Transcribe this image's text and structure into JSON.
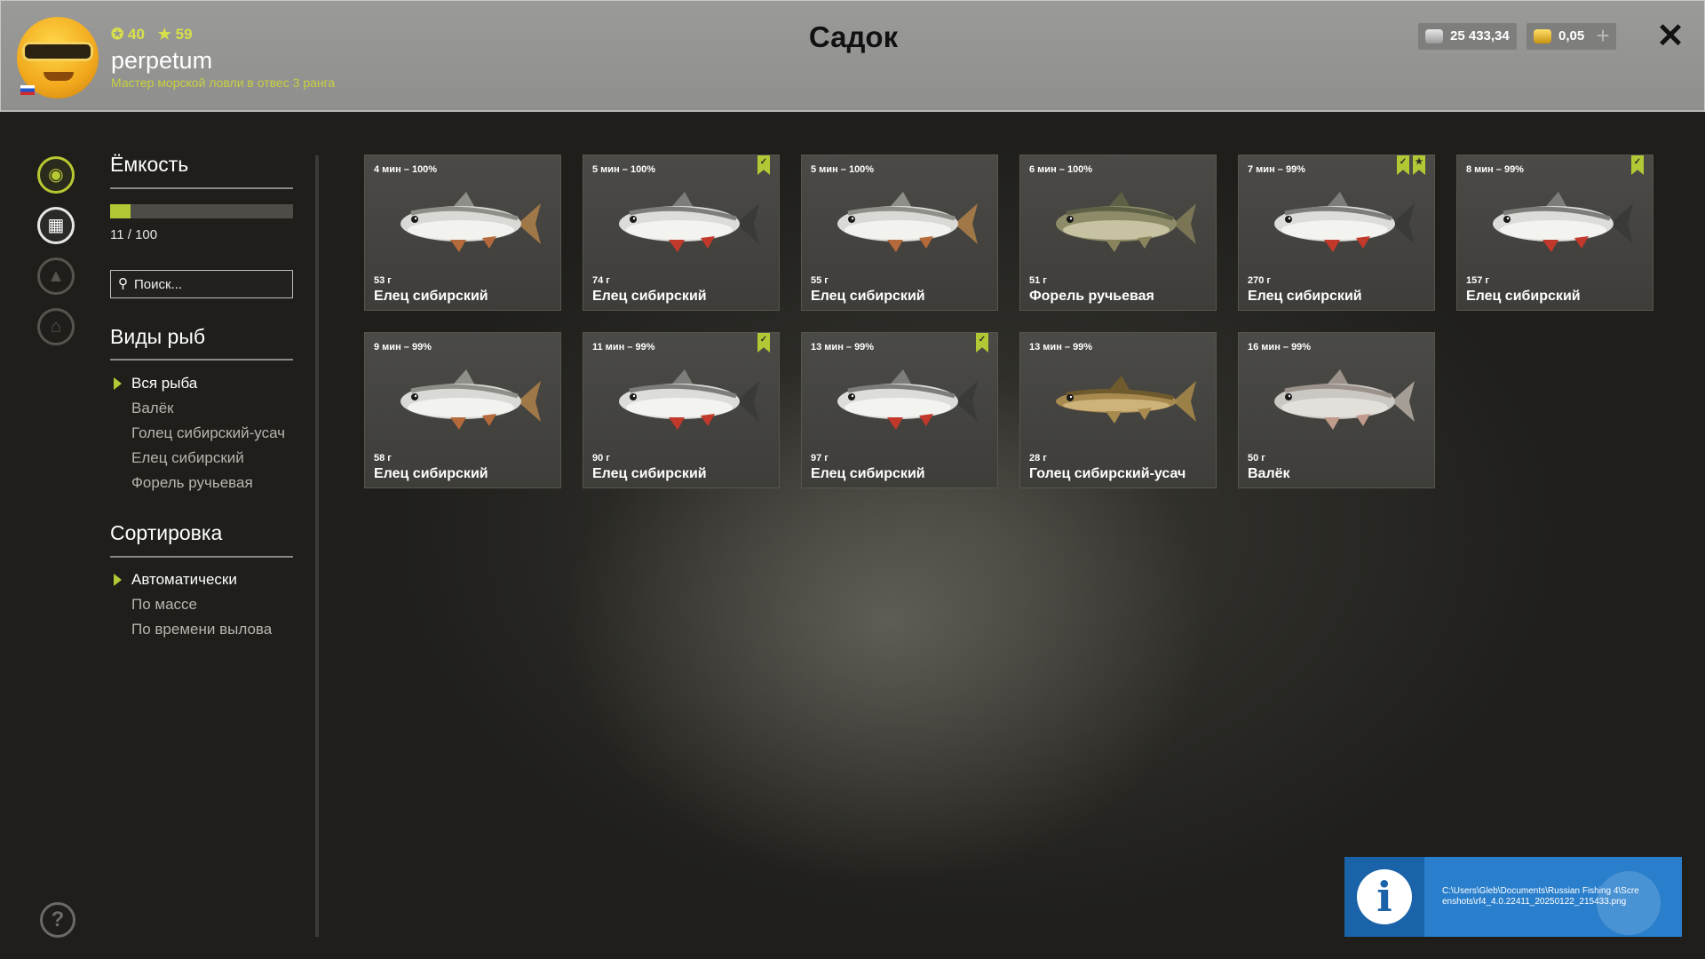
{
  "header": {
    "title": "Садок",
    "player": {
      "level": "40",
      "rank_points": "59",
      "nickname": "perpetum",
      "rank_title": "Мастер морской ловли в отвес 3 ранга"
    },
    "currency": {
      "silver": "25 433,34",
      "gold": "0,05",
      "add_label": "+"
    },
    "close_label": "✕"
  },
  "rail": [
    {
      "icon": "fish-icon",
      "state": "active",
      "glyph": "◉"
    },
    {
      "icon": "keepnet-icon",
      "state": "selected",
      "glyph": "▦"
    },
    {
      "icon": "camp-icon",
      "state": "disabled",
      "glyph": "▲"
    },
    {
      "icon": "home-icon",
      "state": "disabled",
      "glyph": "⌂"
    }
  ],
  "help_label": "?",
  "filters": {
    "capacity_title": "Ёмкость",
    "capacity_current": 11,
    "capacity_max": 100,
    "capacity_text": "11 / 100",
    "search_placeholder": "Поиск...",
    "species_title": "Виды рыб",
    "species": [
      "Вся рыба",
      "Валёк",
      "Голец сибирский-усач",
      "Елец сибирский",
      "Форель ручьевая"
    ],
    "species_selected": 0,
    "sort_title": "Сортировка",
    "sort_options": [
      "Автоматически",
      "По массе",
      "По времени вылова"
    ],
    "sort_selected": 0
  },
  "fish": [
    {
      "time": "4 мин – 100%",
      "weight": "53 г",
      "name": "Елец сибирский",
      "type": "dace-pale",
      "bookmarks": []
    },
    {
      "time": "5 мин – 100%",
      "weight": "74 г",
      "name": "Елец сибирский",
      "type": "dace-dark",
      "bookmarks": [
        "check"
      ]
    },
    {
      "time": "5 мин – 100%",
      "weight": "55 г",
      "name": "Елец сибирский",
      "type": "dace-pale",
      "bookmarks": []
    },
    {
      "time": "6 мин – 100%",
      "weight": "51 г",
      "name": "Форель ручьевая",
      "type": "trout",
      "bookmarks": []
    },
    {
      "time": "7 мин – 99%",
      "weight": "270 г",
      "name": "Елец сибирский",
      "type": "dace-dark",
      "bookmarks": [
        "check",
        "star"
      ]
    },
    {
      "time": "8 мин – 99%",
      "weight": "157 г",
      "name": "Елец сибирский",
      "type": "dace-dark",
      "bookmarks": [
        "check"
      ]
    },
    {
      "time": "9 мин – 99%",
      "weight": "58 г",
      "name": "Елец сибирский",
      "type": "dace-pale",
      "bookmarks": []
    },
    {
      "time": "11 мин – 99%",
      "weight": "90 г",
      "name": "Елец сибирский",
      "type": "dace-dark",
      "bookmarks": [
        "check"
      ]
    },
    {
      "time": "13 мин – 99%",
      "weight": "97 г",
      "name": "Елец сибирский",
      "type": "dace-dark",
      "bookmarks": [
        "check"
      ]
    },
    {
      "time": "13 мин – 99%",
      "weight": "28 г",
      "name": "Голец сибирский-усач",
      "type": "loach",
      "bookmarks": []
    },
    {
      "time": "16 мин – 99%",
      "weight": "50 г",
      "name": "Валёк",
      "type": "whitefish",
      "bookmarks": []
    }
  ],
  "notification": {
    "icon": "info-icon",
    "glyph": "i",
    "text": "C:\\Users\\Gleb\\Documents\\Russian Fishing 4\\Screenshots\\rf4_4.0.22411_20250122_215433.png"
  },
  "colors": {
    "accent": "#b4c735",
    "header_bg": "#979795",
    "notification_bg": "#2a7fcc"
  }
}
